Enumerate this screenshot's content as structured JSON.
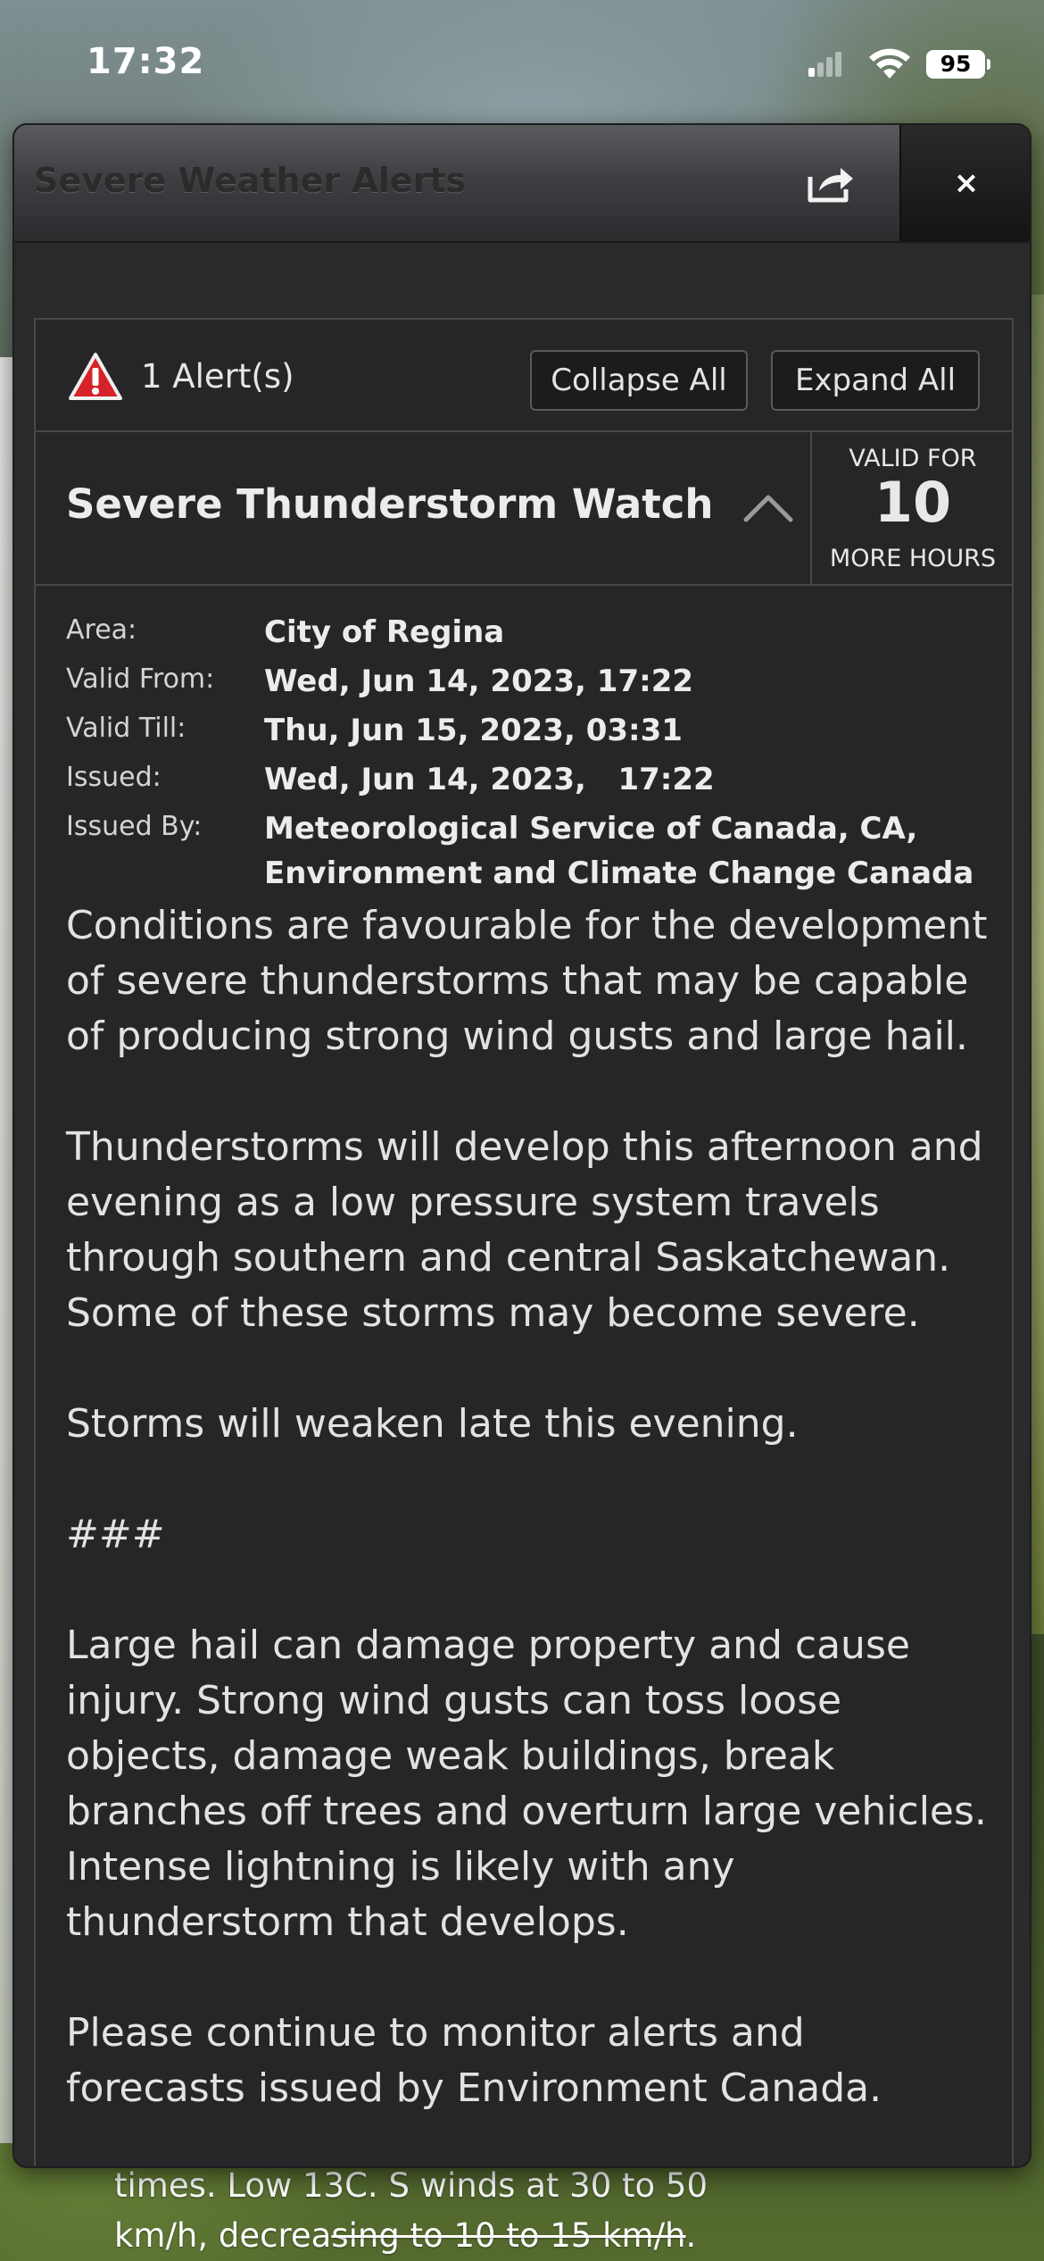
{
  "status_bar": {
    "time": "17:32",
    "battery": "95"
  },
  "background_text": {
    "line1": "times. Low 13C. S winds at 30 to 50",
    "line2_start": "km/h, decrea",
    "line2_strike": "sing to 10 to 15 km/h",
    "line2_end": "."
  },
  "modal": {
    "title": "Severe Weather Alerts",
    "close_label": "×",
    "alert_count": "1 Alert(s)",
    "collapse_all": "Collapse All",
    "expand_all": "Expand All"
  },
  "alert": {
    "title": "Severe Thunderstorm Watch",
    "valid_for_top": "VALID FOR",
    "valid_for_hours": "10",
    "valid_for_bottom": "MORE HOURS",
    "details": {
      "area_label": "Area:",
      "area_value": "City of Regina",
      "valid_from_label": "Valid From:",
      "valid_from_value": "Wed, Jun 14, 2023, 17:22",
      "valid_till_label": "Valid Till:",
      "valid_till_value": "Thu, Jun 15, 2023, 03:31",
      "issued_label": "Issued:",
      "issued_value": "Wed, Jun 14, 2023,   17:22",
      "issued_by_label": "Issued By:",
      "issued_by_line1": "Meteorological Service of Canada, CA,",
      "issued_by_line2": "Environment and Climate Change Canada"
    },
    "paragraphs": [
      "Conditions are favourable for the development of severe thunderstorms that may be capable of producing strong wind gusts and large hail.",
      "Thunderstorms will develop this afternoon and evening as a low pressure system travels through southern and central Saskatchewan. Some of these storms may become severe.",
      "Storms will weaken late this evening.",
      "###",
      "Large hail can damage property and cause injury. Strong wind gusts can toss loose objects, damage weak buildings, break branches off trees and overturn large vehicles. Intense lightning is likely with any thunderstorm that develops.",
      "Please continue to monitor alerts and forecasts issued by Environment Canada."
    ]
  },
  "icons": {
    "warning": "warning-triangle-icon",
    "share": "share-icon",
    "chevron": "chevron-up-icon",
    "wifi": "wifi-icon",
    "signal": "cellular-signal-icon"
  },
  "colors": {
    "warning_red": "#d6232a",
    "panel_bg": "#262628",
    "border": "#48484a"
  }
}
